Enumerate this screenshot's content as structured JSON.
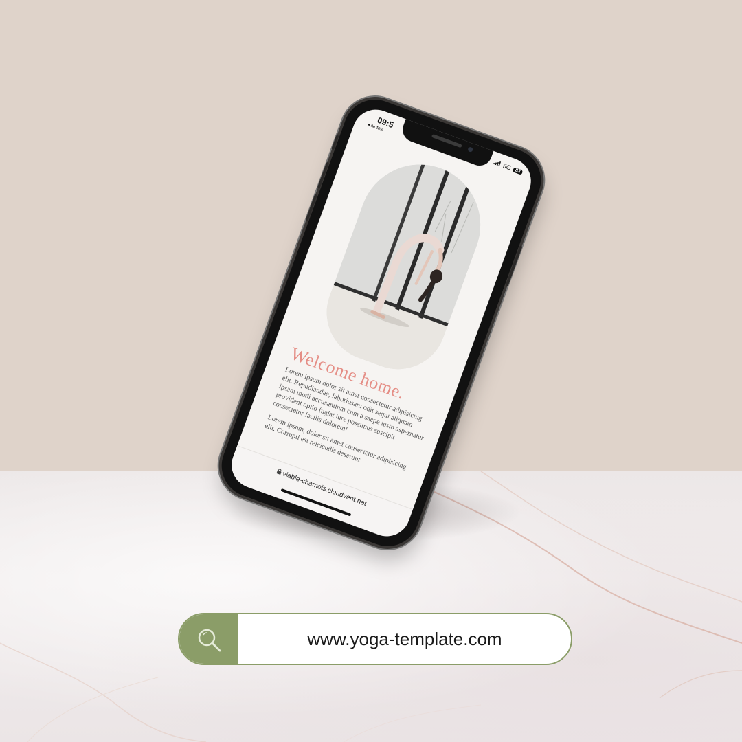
{
  "phone": {
    "status": {
      "time": "09:5",
      "back_label": "◂ Notes",
      "network": "5G",
      "battery": "83"
    },
    "page": {
      "heading": "Welcome home.",
      "paragraph1": "Lorem ipsum dolor sit amet consectetur adipisicing elit. Repudiandae, laboriosam odit sequi aliquam ipsam modi accusantium cum a saepe iusto aspernatur provident optio fugiat iure possimus suscipit consectetur facilis dolorem!",
      "paragraph2": "Lorem ipsum, dolor sit amet consectetur adipisicing elit. Corrupti est reiciendis deserunt"
    },
    "browser": {
      "url": "viable-chamois.cloudvent.net"
    }
  },
  "search": {
    "url": "www.yoga-template.com",
    "icon": "search-icon"
  },
  "colors": {
    "wall": "#dfd3ca",
    "accent_green": "#8b9d68",
    "heading_pink": "#e58e86"
  }
}
